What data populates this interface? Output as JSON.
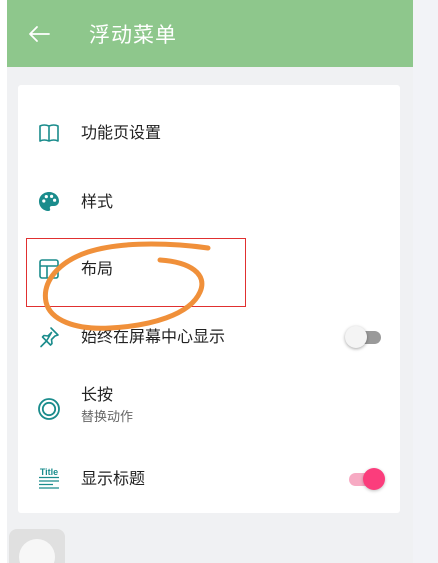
{
  "appbar": {
    "title": "浮动菜单",
    "back_icon": "arrow-left-icon"
  },
  "menu": {
    "items": [
      {
        "label": "功能页设置",
        "icon": "book-open-icon"
      },
      {
        "label": "样式",
        "icon": "palette-icon"
      },
      {
        "label": "布局",
        "icon": "layout-icon"
      },
      {
        "label": "始终在屏幕中心显示",
        "icon": "pin-icon",
        "toggle": "off"
      },
      {
        "label": "长按",
        "sublabel": "替换动作",
        "icon": "ring-icon"
      },
      {
        "label": "显示标题",
        "icon": "title-icon",
        "icon_text": "Title",
        "toggle": "on"
      }
    ]
  },
  "colors": {
    "appbar": "#8ec78c",
    "accent_teal": "#1a8c8c",
    "switch_on": "#fb3d7c",
    "annotation_box": "#e03030",
    "annotation_scribble": "#f0903a"
  }
}
